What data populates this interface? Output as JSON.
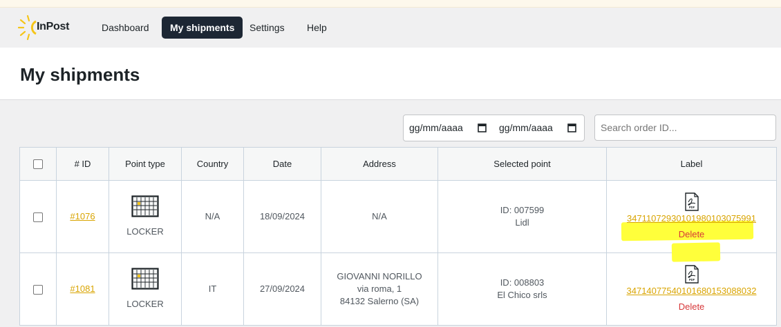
{
  "nav": {
    "logo_text": "InPost",
    "items": [
      {
        "label": "Dashboard",
        "active": false
      },
      {
        "label": "My shipments",
        "active": true
      },
      {
        "label": "Settings",
        "active": false
      },
      {
        "label": "Help",
        "active": false
      }
    ]
  },
  "header": {
    "title": "My shipments"
  },
  "filters": {
    "date_from": "gg/mm/aaaa",
    "date_to": "gg/mm/aaaa",
    "search_placeholder": "Search order ID..."
  },
  "table": {
    "columns": [
      "# ID",
      "Point type",
      "Country",
      "Date",
      "Address",
      "Selected point",
      "Label"
    ],
    "rows": [
      {
        "id": "#1076",
        "point_type": "LOCKER",
        "country": "N/A",
        "date": "18/09/2024",
        "address": [
          "N/A"
        ],
        "selected_point": [
          "ID: 007599",
          "Lidl"
        ],
        "label_number": "347110729301019801030759​91",
        "delete_label": "Delete",
        "highlighted": true
      },
      {
        "id": "#1081",
        "point_type": "LOCKER",
        "country": "IT",
        "date": "27/09/2024",
        "address": [
          "GIOVANNI NORILLO",
          "via roma, 1",
          "84132 Salerno (SA)"
        ],
        "selected_point": [
          "ID: 008803",
          "El Chico srls"
        ],
        "label_number": "347140775401016801530880​32",
        "delete_label": "Delete",
        "highlighted": false
      }
    ]
  },
  "colors": {
    "accent": "#d9a400",
    "nav_active_bg": "#1d2734",
    "delete": "#d63638",
    "highlight": "#ffff3b"
  },
  "icons": {
    "logo": "inpost-sun-logo",
    "calendar": "calendar-icon",
    "locker": "parcel-locker-icon",
    "pdf": "pdf-file-icon"
  }
}
